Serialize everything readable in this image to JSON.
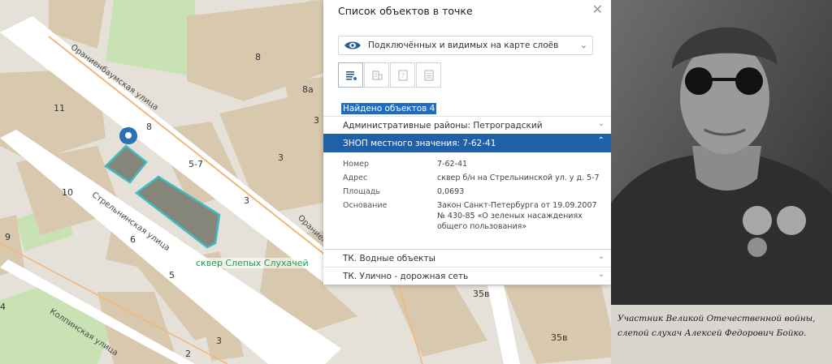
{
  "map": {
    "building_numbers": [
      "8",
      "8а",
      "11",
      "8",
      "5-7",
      "3",
      "3",
      "10",
      "3",
      "9",
      "6",
      "5",
      "4",
      "35в",
      "35в",
      "2",
      "3"
    ],
    "streets": {
      "oranienbaum": "Ораниенбаумская улица",
      "strelninskaya": "Стрельнинская улица",
      "kolpinskaya": "Колпинская улица",
      "oranienbaum_right": "Ораниен"
    },
    "park_label": "сквер Слепых Слухачей",
    "colors": {
      "park": "#c8e2b4",
      "building": "#d7c9b0",
      "road": "#ffffff",
      "highlight": "#3dbdc3"
    },
    "pin_icon": "map-pin-icon"
  },
  "panel": {
    "title": "Список объектов в точке",
    "close_icon": "close-icon",
    "layers_select": {
      "label": "Подключённых и видимых на карте слоёв",
      "icon": "eye-icon"
    },
    "tools": [
      "list-icon",
      "building-icon",
      "question-doc-icon",
      "document-icon"
    ],
    "found": "Найдено объектов 4",
    "sections": [
      {
        "label": "Административные районы: Петроградский",
        "expanded": false
      },
      {
        "label": "ЗНОП местного значения: 7-62-41",
        "expanded": true
      },
      {
        "label": "ТК. Водные объекты",
        "expanded": false
      },
      {
        "label": "ТК. Улично - дорожная сеть",
        "expanded": false
      }
    ],
    "details": [
      {
        "key": "Номер",
        "value": "7-62-41"
      },
      {
        "key": "Адрес",
        "value": "сквер б/н на Стрельнинской ул. у д. 5-7"
      },
      {
        "key": "Площадь",
        "value": "0,0693"
      },
      {
        "key": "Основание",
        "value": "Закон Санкт-Петербурга от 19.09.2007 № 430-85 «О зеленых насаждениях общего пользования»"
      }
    ],
    "colors": {
      "accent": "#1f60a8",
      "found_bg": "#1d6ec2"
    }
  },
  "photo": {
    "caption": "Участник Великой Отечественной войны, слепой слухач Алексей Федорович Бойко."
  }
}
